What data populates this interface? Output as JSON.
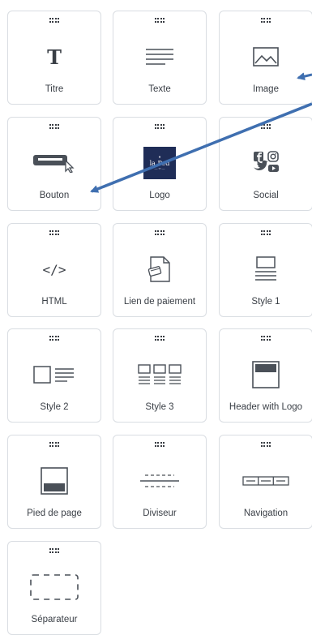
{
  "blocks": [
    {
      "label": "Titre",
      "icon": "title-text-icon",
      "glyph": "T"
    },
    {
      "label": "Texte",
      "icon": "text-lines-icon"
    },
    {
      "label": "Image",
      "icon": "image-icon"
    },
    {
      "label": "Bouton",
      "icon": "button-click-icon"
    },
    {
      "label": "Logo",
      "icon": "logo-thumbnail",
      "logo": {
        "line1": "♦",
        "line2": "la Ped",
        "line3": "— ∞ —"
      }
    },
    {
      "label": "Social",
      "icon": "social-icons"
    },
    {
      "label": "HTML",
      "icon": "code-icon",
      "glyph": "</>"
    },
    {
      "label": "Lien de paiement",
      "icon": "payment-link-icon"
    },
    {
      "label": "Style 1",
      "icon": "style-1-layout-icon"
    },
    {
      "label": "Style 2",
      "icon": "style-2-layout-icon"
    },
    {
      "label": "Style 3",
      "icon": "style-3-layout-icon"
    },
    {
      "label": "Header with Logo",
      "icon": "header-logo-layout-icon"
    },
    {
      "label": "Pied de page",
      "icon": "footer-layout-icon"
    },
    {
      "label": "Diviseur",
      "icon": "divider-icon"
    },
    {
      "label": "Navigation",
      "icon": "navigation-bar-icon"
    },
    {
      "label": "Séparateur",
      "icon": "spacer-dashed-icon"
    }
  ],
  "colors": {
    "border": "#d9dde2",
    "icon": "#4a5058",
    "text": "#3a3f46",
    "arrow": "#3f6fb0",
    "logo_bg": "#1f2d57"
  }
}
